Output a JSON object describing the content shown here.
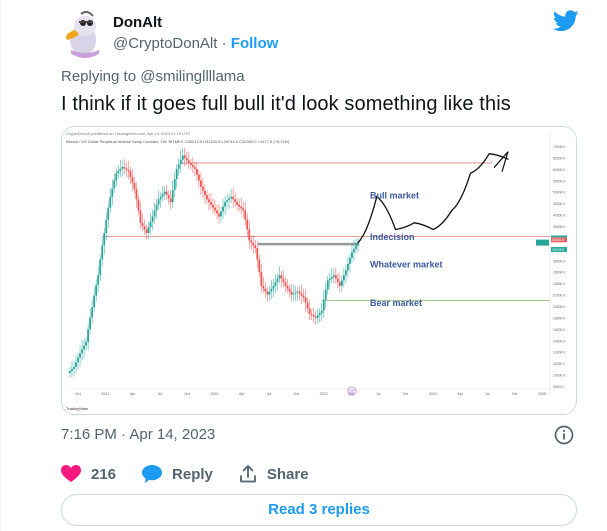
{
  "author": {
    "display_name": "DonAlt",
    "handle": "@CryptoDonAlt",
    "separator": "·",
    "follow_label": "Follow"
  },
  "tweet": {
    "replying_to_prefix": "Replying to ",
    "replying_to_handle": "@smilingllllama",
    "text": "I think if it goes full bull it'd look something like this",
    "timestamp": "7:16 PM · Apr 14, 2023"
  },
  "chart_data": {
    "type": "line",
    "title": "",
    "source_header": "CryptoDonAlt published on TradingView.com, Apr 14, 2023 21:15 UTC",
    "symbol_line": "Bitcoin / US Dollar Perpetual Inverse Swap Contract, 1W, BITMEX  O30213.5  H31100.0  L29743.5  C30394.0  +1477.5 (+5.11%)",
    "watermark": "TradingView",
    "annotations": [
      "Bull market",
      "Indecision",
      "Whatever market",
      "Bear market"
    ],
    "x_tick_labels": [
      "Oct",
      "2021",
      "Apr",
      "Jul",
      "Oct",
      "2022",
      "Apr",
      "Jul",
      "Oct",
      "2023",
      "Apr",
      "Jul",
      "Oct",
      "2024",
      "Apr",
      "Jul",
      "Oct",
      "2025"
    ],
    "y_tick_labels": [
      "70000.0",
      "65000.0",
      "60000.0",
      "55000.0",
      "50000.0",
      "45000.0",
      "40000.0",
      "35000.0",
      "32000.0",
      "30000.0",
      "28000.0",
      "26000.0",
      "24000.0",
      "22000.0",
      "20000.0",
      "18000.0",
      "16000.0",
      "14000.0",
      "12000.0",
      "11000.0",
      "10000.0",
      "9000.0"
    ],
    "horizontal_levels": [
      {
        "name": "top resistance",
        "value": 60000,
        "color": "#e06666"
      },
      {
        "name": "indecision upper",
        "value": 32000,
        "color": "#e06666"
      },
      {
        "name": "indecision lower",
        "value": 30000,
        "color": "#999999"
      },
      {
        "name": "bear line",
        "value": 18500,
        "color": "#6aa84f"
      }
    ],
    "price_markers": [
      "30394.0",
      "31100.0",
      "29743.5"
    ],
    "series": [
      {
        "name": "",
        "values": [
          10500,
          11800,
          13000,
          17500,
          23000,
          33000,
          45000,
          55000,
          58000,
          56000,
          48000,
          36000,
          33000,
          38000,
          44000,
          47000,
          43000,
          57000,
          64000,
          60000,
          57000,
          49000,
          44000,
          41000,
          38000,
          43000,
          45000,
          42000,
          40000,
          31000,
          29000,
          21000,
          19500,
          21000,
          23000,
          21000,
          19500,
          20000,
          19000,
          16500,
          16000,
          17000,
          22000,
          23000,
          21000,
          24000,
          28000,
          30394
        ]
      }
    ],
    "projection_points": [
      30394,
      45000,
      34000,
      36000,
      34000,
      40000,
      55000,
      65000,
      62000
    ]
  },
  "colors": {
    "accent": "#1d9bf0",
    "like": "#f91880",
    "up_candle": "#26a69a",
    "down_candle": "#ef5350"
  },
  "actions": {
    "like_count": "216",
    "reply_label": "Reply",
    "share_label": "Share"
  },
  "footer": {
    "read_replies_label": "Read 3 replies"
  }
}
